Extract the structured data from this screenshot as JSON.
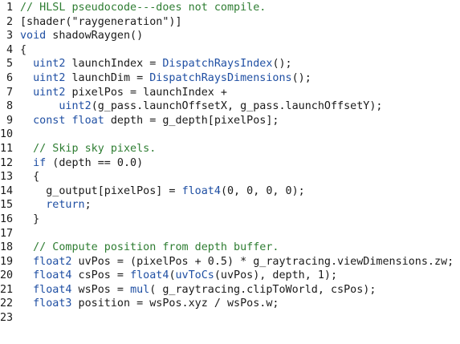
{
  "lines": [
    {
      "num": "1",
      "indent": "",
      "tokens": [
        {
          "t": "// HLSL pseudocode---does not compile.",
          "c": "comment"
        }
      ]
    },
    {
      "num": "2",
      "indent": "",
      "tokens": [
        {
          "t": "[shader(\"raygeneration\")]",
          "c": "plain"
        }
      ]
    },
    {
      "num": "3",
      "indent": "",
      "tokens": [
        {
          "t": "void",
          "c": "keyword"
        },
        {
          "t": " shadowRaygen()",
          "c": "plain"
        }
      ]
    },
    {
      "num": "4",
      "indent": "",
      "tokens": [
        {
          "t": "{",
          "c": "plain"
        }
      ]
    },
    {
      "num": "5",
      "indent": "  ",
      "tokens": [
        {
          "t": "uint2",
          "c": "keyword"
        },
        {
          "t": " launchIndex = ",
          "c": "plain"
        },
        {
          "t": "DispatchRaysIndex",
          "c": "func"
        },
        {
          "t": "();",
          "c": "plain"
        }
      ]
    },
    {
      "num": "6",
      "indent": "  ",
      "tokens": [
        {
          "t": "uint2",
          "c": "keyword"
        },
        {
          "t": " launchDim = ",
          "c": "plain"
        },
        {
          "t": "DispatchRaysDimensions",
          "c": "func"
        },
        {
          "t": "();",
          "c": "plain"
        }
      ]
    },
    {
      "num": "7",
      "indent": "  ",
      "tokens": [
        {
          "t": "uint2",
          "c": "keyword"
        },
        {
          "t": " pixelPos = launchIndex +",
          "c": "plain"
        }
      ]
    },
    {
      "num": "8",
      "indent": "      ",
      "tokens": [
        {
          "t": "uint2",
          "c": "keyword"
        },
        {
          "t": "(g_pass.launchOffsetX, g_pass.launchOffsetY);",
          "c": "plain"
        }
      ]
    },
    {
      "num": "9",
      "indent": "  ",
      "tokens": [
        {
          "t": "const",
          "c": "keyword"
        },
        {
          "t": " ",
          "c": "plain"
        },
        {
          "t": "float",
          "c": "keyword"
        },
        {
          "t": " depth = g_depth[pixelPos];",
          "c": "plain"
        }
      ]
    },
    {
      "num": "10",
      "indent": "",
      "tokens": []
    },
    {
      "num": "11",
      "indent": "  ",
      "tokens": [
        {
          "t": "// Skip sky pixels.",
          "c": "comment"
        }
      ]
    },
    {
      "num": "12",
      "indent": "  ",
      "tokens": [
        {
          "t": "if",
          "c": "keyword"
        },
        {
          "t": " (depth == 0.0)",
          "c": "plain"
        }
      ]
    },
    {
      "num": "13",
      "indent": "  ",
      "tokens": [
        {
          "t": "{",
          "c": "plain"
        }
      ]
    },
    {
      "num": "14",
      "indent": "    ",
      "tokens": [
        {
          "t": "g_output[pixelPos] = ",
          "c": "plain"
        },
        {
          "t": "float4",
          "c": "keyword"
        },
        {
          "t": "(0, 0, 0, 0);",
          "c": "plain"
        }
      ]
    },
    {
      "num": "15",
      "indent": "    ",
      "tokens": [
        {
          "t": "return",
          "c": "keyword"
        },
        {
          "t": ";",
          "c": "plain"
        }
      ]
    },
    {
      "num": "16",
      "indent": "  ",
      "tokens": [
        {
          "t": "}",
          "c": "plain"
        }
      ]
    },
    {
      "num": "17",
      "indent": "",
      "tokens": []
    },
    {
      "num": "18",
      "indent": "  ",
      "tokens": [
        {
          "t": "// Compute position from depth buffer.",
          "c": "comment"
        }
      ]
    },
    {
      "num": "19",
      "indent": "  ",
      "tokens": [
        {
          "t": "float2",
          "c": "keyword"
        },
        {
          "t": " uvPos = (pixelPos + 0.5) * g_raytracing.viewDimensions.zw;",
          "c": "plain"
        }
      ]
    },
    {
      "num": "20",
      "indent": "  ",
      "tokens": [
        {
          "t": "float4",
          "c": "keyword"
        },
        {
          "t": " csPos = ",
          "c": "plain"
        },
        {
          "t": "float4",
          "c": "keyword"
        },
        {
          "t": "(",
          "c": "plain"
        },
        {
          "t": "uvToCs",
          "c": "func"
        },
        {
          "t": "(uvPos), depth, 1);",
          "c": "plain"
        }
      ]
    },
    {
      "num": "21",
      "indent": "  ",
      "tokens": [
        {
          "t": "float4",
          "c": "keyword"
        },
        {
          "t": " wsPos = ",
          "c": "plain"
        },
        {
          "t": "mul",
          "c": "func"
        },
        {
          "t": "( g_raytracing.clipToWorld, csPos);",
          "c": "plain"
        }
      ]
    },
    {
      "num": "22",
      "indent": "  ",
      "tokens": [
        {
          "t": "float3",
          "c": "keyword"
        },
        {
          "t": " position = wsPos.xyz / wsPos.w;",
          "c": "plain"
        }
      ]
    },
    {
      "num": "23",
      "indent": "",
      "tokens": []
    }
  ],
  "colors": {
    "comment": "#2e7d32",
    "keyword": "#1f4fa3",
    "text": "#1a1a1a"
  }
}
